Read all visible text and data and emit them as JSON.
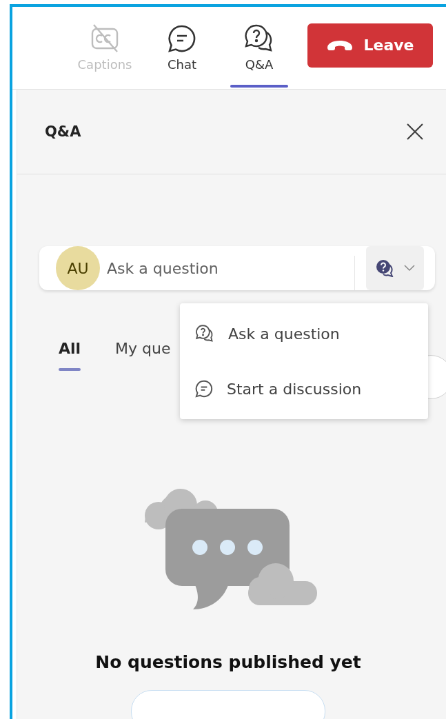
{
  "toolbar": {
    "items": [
      {
        "kind": "captions",
        "label": "Captions",
        "selected": false,
        "disabled": true
      },
      {
        "kind": "chat",
        "label": "Chat",
        "selected": false,
        "disabled": false
      },
      {
        "kind": "qa",
        "label": "Q&A",
        "selected": true,
        "disabled": false
      }
    ],
    "leave_button": "Leave"
  },
  "panel": {
    "title": "Q&A",
    "composer": {
      "avatar": "AU",
      "placeholder": "Ask a question"
    },
    "tabs": [
      {
        "label": "All",
        "selected": true
      },
      {
        "label": "My que",
        "selected": false
      }
    ],
    "menu": [
      {
        "kind": "question",
        "label": "Ask a question"
      },
      {
        "kind": "discussion",
        "label": "Start a discussion"
      }
    ],
    "empty_state": {
      "title": "No questions published yet"
    }
  }
}
